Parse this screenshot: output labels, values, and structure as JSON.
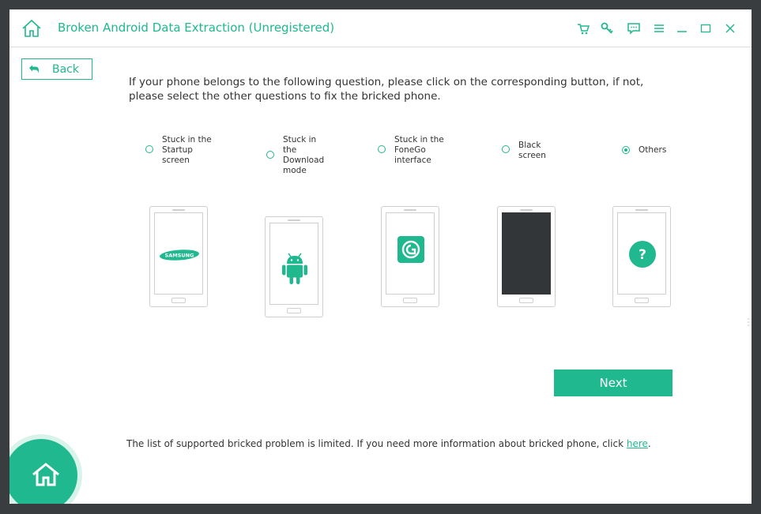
{
  "app": {
    "title": "Broken Android Data Extraction (Unregistered)",
    "accent_color": "#1fb88f",
    "title_icons": [
      "home-icon"
    ],
    "window_controls": [
      "cart-icon",
      "key-icon",
      "feedback-icon",
      "menu-icon",
      "minimize-icon",
      "maximize-icon",
      "close-icon"
    ]
  },
  "toolbar": {
    "back_label": "Back"
  },
  "main": {
    "instruction": "If your phone belongs to the following question, please click on the corresponding button, if not, please select the other questions to fix the bricked phone.",
    "options": [
      {
        "label": "Stuck in the Startup screen",
        "selected": false,
        "screen_icon": "samsung-logo-icon",
        "screen_text": "SAMSUNG"
      },
      {
        "label": "Stuck in the Download mode",
        "selected": false,
        "screen_icon": "android-robot-icon"
      },
      {
        "label": "Stuck in the FoneGo interface",
        "selected": false,
        "screen_icon": "fonego-logo-icon"
      },
      {
        "label": "Black screen",
        "selected": false,
        "screen_icon": "black-screen"
      },
      {
        "label": "Others",
        "selected": true,
        "screen_icon": "question-mark-icon"
      }
    ],
    "next_label": "Next"
  },
  "footer": {
    "note_prefix": "The list of supported bricked problem is limited. If you need more information about bricked phone, click ",
    "link_text": "here",
    "note_suffix": "."
  }
}
